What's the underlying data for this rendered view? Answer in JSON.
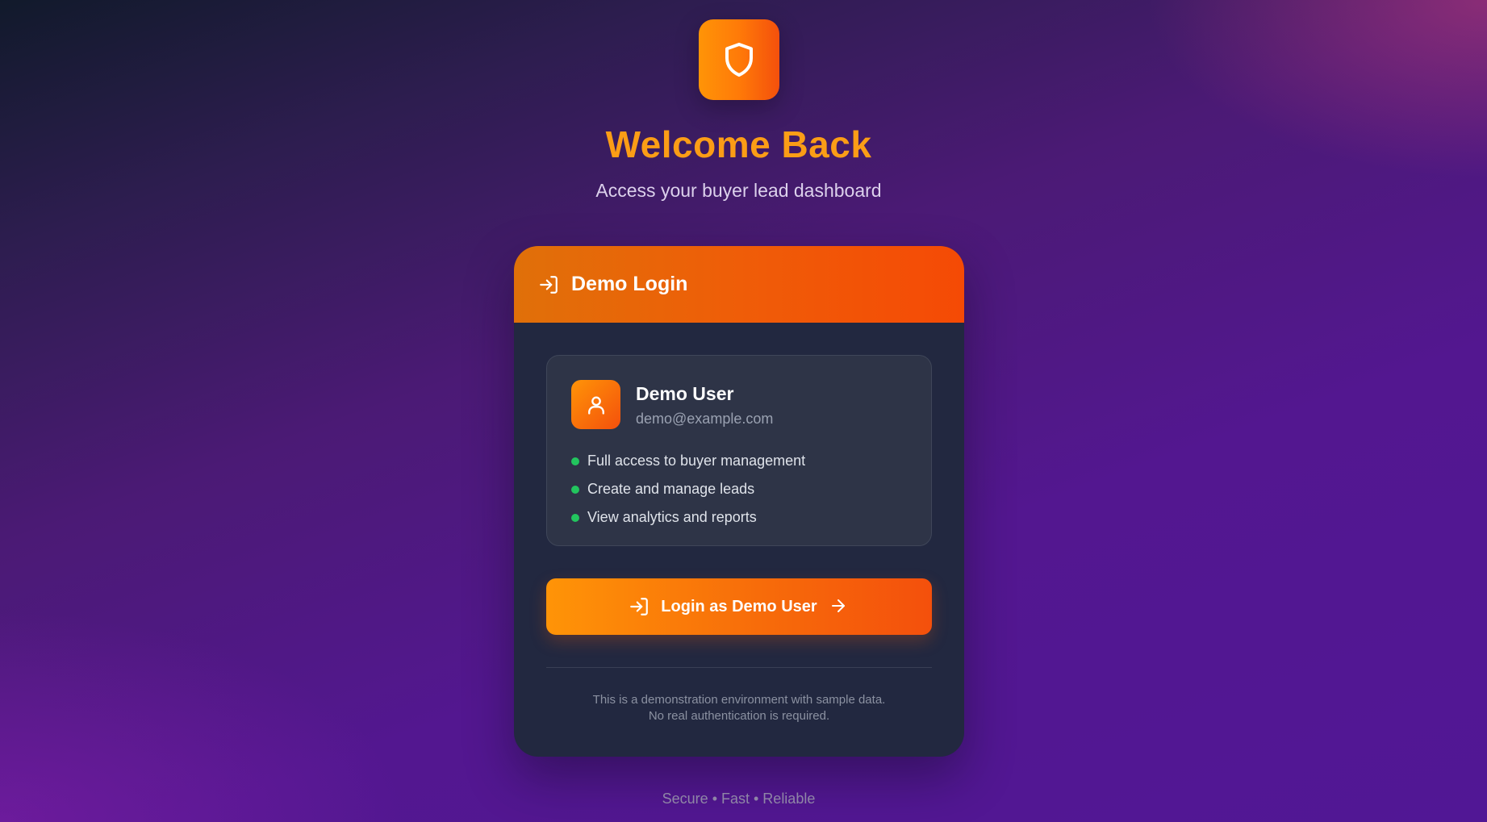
{
  "header": {
    "logo_icon": "shield-icon",
    "title": "Welcome Back",
    "subtitle": "Access your buyer lead dashboard"
  },
  "card": {
    "header_icon": "log-in-icon",
    "header_title": "Demo Login",
    "user": {
      "avatar_icon": "user-icon",
      "name": "Demo User",
      "email": "demo@example.com"
    },
    "features": [
      "Full access to buyer management",
      "Create and manage leads",
      "View analytics and reports"
    ],
    "login_button": {
      "icon": "log-in-icon",
      "label": "Login as Demo User",
      "trailing_icon": "arrow-right-icon"
    },
    "note_line_1": "This is a demonstration environment with sample data.",
    "note_line_2": "No real authentication is required."
  },
  "footer": "Secure • Fast • Reliable",
  "colors": {
    "brand_orange": "#ff9407",
    "brand_orange_deep": "#f4500c",
    "title_orange": "#fb9d16",
    "card_bg": "#222840",
    "user_box_bg": "#2e3447",
    "feature_dot": "#22c55e",
    "background_purple": "#531790"
  }
}
